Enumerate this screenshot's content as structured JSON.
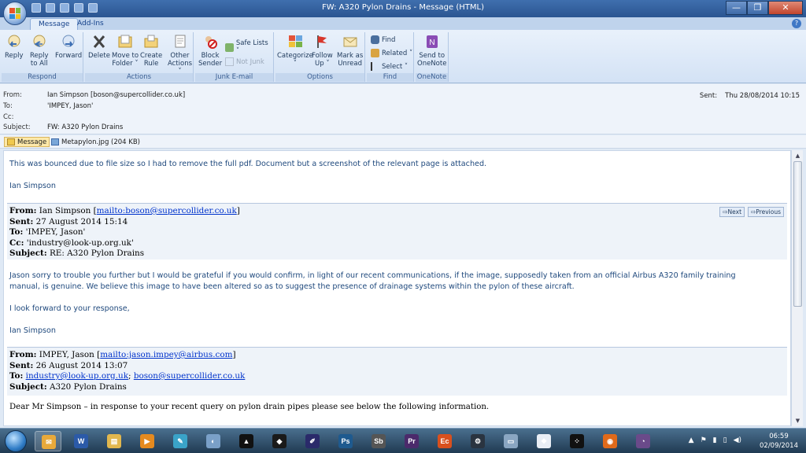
{
  "window": {
    "title": "FW: A320 Pylon Drains - Message (HTML)",
    "minimize": "—",
    "maximize": "❐",
    "close": "✕"
  },
  "tabs": [
    {
      "label": "Message",
      "active": true
    },
    {
      "label": "Add-Ins",
      "active": false
    }
  ],
  "ribbon": {
    "respond": {
      "label": "Respond",
      "reply": "Reply",
      "reply_all_1": "Reply",
      "reply_all_2": "to All",
      "forward": "Forward"
    },
    "actions": {
      "label": "Actions",
      "delete": "Delete",
      "move_1": "Move to",
      "move_2": "Folder ˅",
      "create_1": "Create",
      "create_2": "Rule",
      "other_1": "Other",
      "other_2": "Actions ˅"
    },
    "junk": {
      "label": "Junk E-mail",
      "block_1": "Block",
      "block_2": "Sender",
      "safe_lists": "Safe Lists ˅",
      "not_junk": "Not Junk"
    },
    "options": {
      "label": "Options",
      "categorize_1": "Categorize",
      "categorize_2": "˅",
      "follow_1": "Follow",
      "follow_2": "Up ˅",
      "mark_1": "Mark as",
      "mark_2": "Unread"
    },
    "find": {
      "label": "Find",
      "find": "Find",
      "related": "Related ˅",
      "select": "Select ˅"
    },
    "onenote": {
      "label": "OneNote",
      "send_1": "Send to",
      "send_2": "OneNote"
    }
  },
  "header": {
    "from_label": "From:",
    "from": "Ian Simpson [boson@supercollider.co.uk]",
    "to_label": "To:",
    "to": "'IMPEY, Jason'",
    "cc_label": "Cc:",
    "cc": "",
    "subject_label": "Subject:",
    "subject": "FW: A320 Pylon Drains",
    "sent_label": "Sent:",
    "sent": "Thu 28/08/2014 10:15"
  },
  "attachments": [
    {
      "label": "Message",
      "selected": true
    },
    {
      "label": "Metapylon.jpg (204 KB)",
      "selected": false
    }
  ],
  "body": {
    "intro": "This was bounced due to file size so I had to remove the full pdf. Document but a screenshot of the relevant page is attached.",
    "sig1": "Ian Simpson",
    "q1": {
      "from_label": "From:",
      "from_name": " Ian Simpson [",
      "from_link": "mailto:boson@supercollider.co.uk",
      "from_end": "]",
      "sent_label": "Sent:",
      "sent": " 27 August 2014 15:14",
      "to_label": "To:",
      "to": " 'IMPEY, Jason'",
      "cc_label": "Cc:",
      "cc": " 'industry@look-up.org.uk'",
      "subject_label": "Subject:",
      "subject": " RE: A320 Pylon Drains",
      "next": "⇨Next",
      "previous": "⇨Previous"
    },
    "para1": "Jason sorry to trouble you further but I would be grateful if you would confirm, in light of our recent communications, if the image, supposedly taken from an official Airbus A320 family training manual, is genuine. We believe this image to have been altered so as to suggest the presence of drainage systems within the pylon of these aircraft.",
    "para2": "I look forward to your response,",
    "sig2": "Ian Simpson",
    "q2": {
      "from_label": "From:",
      "from_name": " IMPEY, Jason [",
      "from_link": "mailto:jason.impey@airbus.com",
      "from_end": "]",
      "sent_label": "Sent:",
      "sent": " 26 August 2014 13:07",
      "to_label": "To:",
      "to_link1": "industry@look-up.org.uk",
      "to_sep": "; ",
      "to_link2": "boson@supercollider.co.uk",
      "subject_label": "Subject:",
      "subject": " A320 Pylon Drains"
    },
    "para3": "Dear Mr Simpson – in response to your recent query on pylon drain pipes please see below the following information."
  },
  "taskbar": {
    "time": "06:59",
    "date": "02/09/2014",
    "apps": [
      {
        "icon": "outlook-icon",
        "glyph": "✉",
        "color": "#e8a93a"
      },
      {
        "icon": "word-icon",
        "glyph": "W",
        "color": "#2b5aa8"
      },
      {
        "icon": "explorer-icon",
        "glyph": "▤",
        "color": "#e1b74e"
      },
      {
        "icon": "media-icon",
        "glyph": "▶",
        "color": "#e58a1f"
      },
      {
        "icon": "notes-icon",
        "glyph": "✎",
        "color": "#3aa3c8"
      },
      {
        "icon": "paint-icon",
        "glyph": "◐",
        "color": "#7aa0c8"
      },
      {
        "icon": "rhombus-icon",
        "glyph": "▲",
        "color": "#111111"
      },
      {
        "icon": "gamepad-icon",
        "glyph": "◆",
        "color": "#1a1a1a"
      },
      {
        "icon": "pen-icon",
        "glyph": "✐",
        "color": "#2a2a6a"
      },
      {
        "icon": "photoshop-icon",
        "glyph": "Ps",
        "color": "#1e5a8f"
      },
      {
        "icon": "soundbooth-icon",
        "glyph": "Sb",
        "color": "#555555"
      },
      {
        "icon": "premiere-icon",
        "glyph": "Pr",
        "color": "#4b2a6b"
      },
      {
        "icon": "slides-icon",
        "glyph": "Ec",
        "color": "#d9501e"
      },
      {
        "icon": "steam-icon",
        "glyph": "⚙",
        "color": "#2a3440"
      },
      {
        "icon": "monitor-icon",
        "glyph": "▭",
        "color": "#8aa6c2"
      },
      {
        "icon": "image-icon",
        "glyph": "❖",
        "color": "#e9eef5"
      },
      {
        "icon": "blackberry-icon",
        "glyph": "⁘",
        "color": "#111111"
      },
      {
        "icon": "firefox-icon",
        "glyph": "◉",
        "color": "#e06a1b"
      },
      {
        "icon": "tor-icon",
        "glyph": "◔",
        "color": "#6a4a8a"
      }
    ]
  }
}
